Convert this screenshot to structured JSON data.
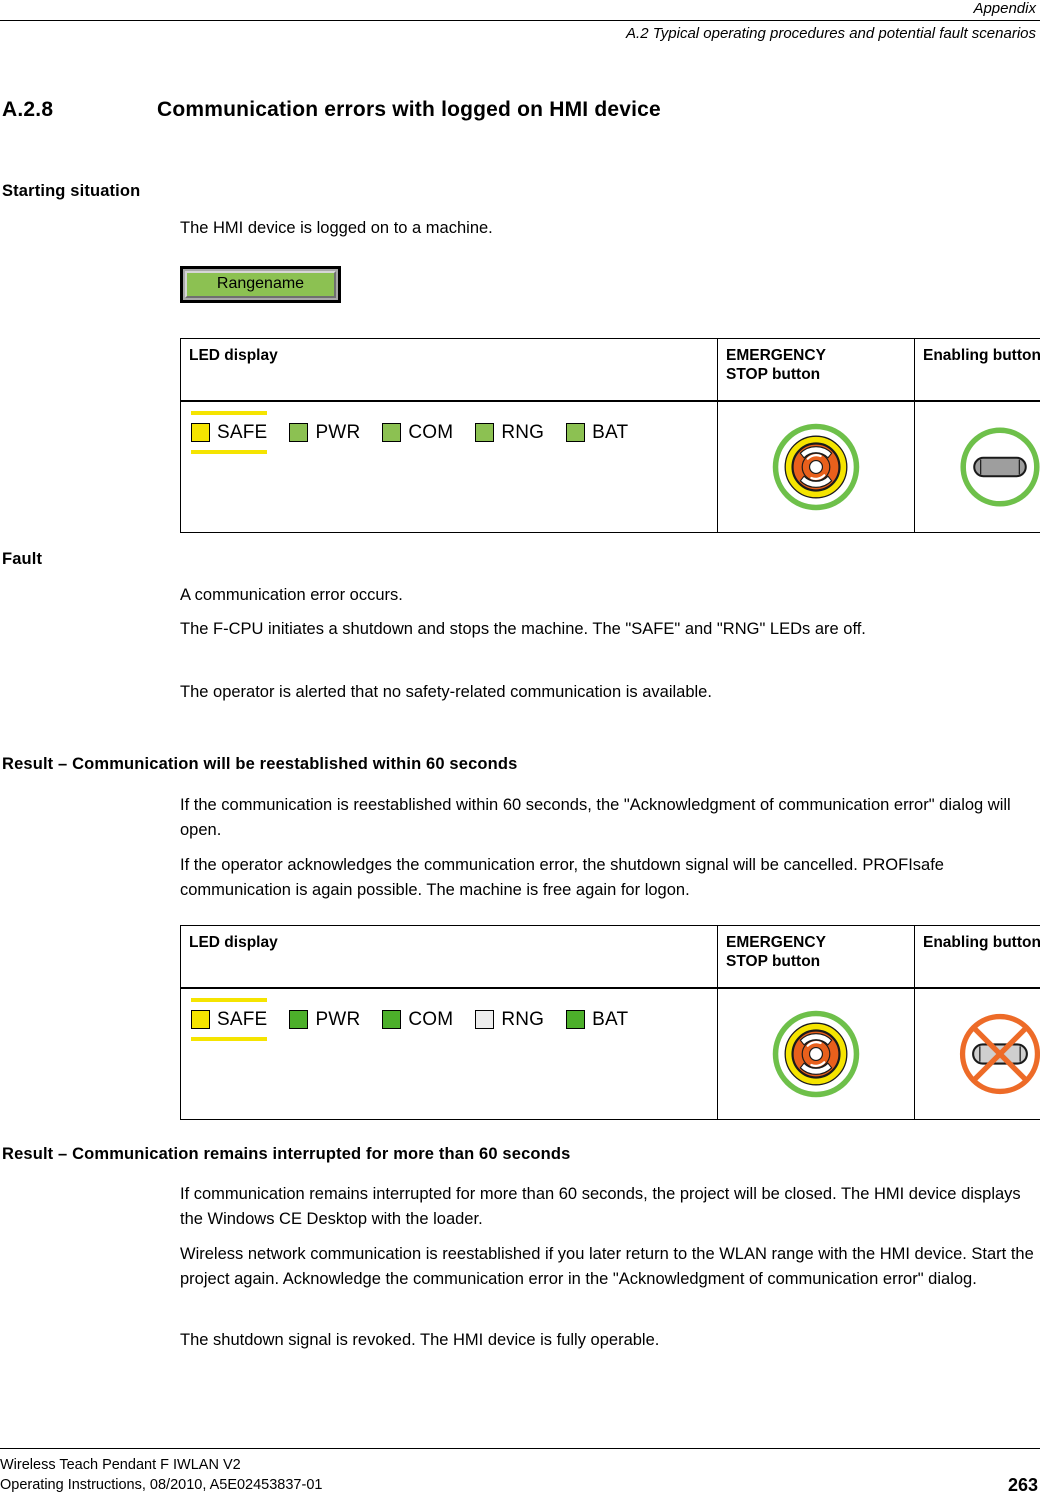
{
  "header": {
    "right_top": "Appendix",
    "right_sub": "A.2 Typical operating procedures and potential fault scenarios"
  },
  "section": {
    "number": "A.2.8",
    "title": "Communication errors with logged on HMI device"
  },
  "starting_situation": {
    "heading": "Starting situation",
    "paragraph": "The HMI device is logged on to a machine.",
    "rangename_button": "Rangename"
  },
  "table_headers": {
    "led": "LED display",
    "estop": "EMERGENCY STOP button",
    "estop_line1": "EMERGENCY",
    "estop_line2": "STOP button",
    "enabling": "Enabling button"
  },
  "table_one": {
    "leds": [
      {
        "label": "SAFE",
        "color": "#f5e400",
        "state": "on",
        "marked": true
      },
      {
        "label": "PWR",
        "color": "#8cc152",
        "state": "on",
        "marked": false
      },
      {
        "label": "COM",
        "color": "#8cc152",
        "state": "on",
        "marked": false
      },
      {
        "label": "RNG",
        "color": "#8cc152",
        "state": "on",
        "marked": false
      },
      {
        "label": "BAT",
        "color": "#8cc152",
        "state": "on",
        "marked": false
      }
    ],
    "estop_icon": "emergency-stop-button-icon",
    "enabling_icon": "enabling-button-icon",
    "enabling_disabled": false
  },
  "table_two": {
    "leds": [
      {
        "label": "SAFE",
        "color": "#f5e400",
        "state": "on",
        "marked": true
      },
      {
        "label": "PWR",
        "color": "#4caf2a",
        "state": "on",
        "marked": false
      },
      {
        "label": "COM",
        "color": "#4caf2a",
        "state": "on",
        "marked": false
      },
      {
        "label": "RNG",
        "color": "#ededed",
        "state": "off",
        "marked": false
      },
      {
        "label": "BAT",
        "color": "#4caf2a",
        "state": "on",
        "marked": false
      }
    ],
    "estop_icon": "emergency-stop-button-icon",
    "enabling_icon": "enabling-button-disabled-icon",
    "enabling_disabled": true
  },
  "fault": {
    "heading": "Fault",
    "p1": "A communication error occurs.",
    "p2": "The F-CPU initiates a shutdown and stops the machine. The \"SAFE\" and \"RNG\" LEDs are off.",
    "p3": "The operator is alerted that no safety-related communication is available."
  },
  "result_reestablished": {
    "heading": "Result – Communication will be reestablished within 60 seconds",
    "p1": "If the communication is reestablished within 60 seconds, the \"Acknowledgment of communication error\" dialog will open.",
    "p2": "If the operator acknowledges the communication error, the shutdown signal will be cancelled. PROFIsafe communication is again possible. The machine is free again for logon."
  },
  "result_interrupted": {
    "heading": "Result – Communication remains interrupted for more than 60 seconds",
    "p1": "If communication remains interrupted for more than 60 seconds, the project will be closed. The HMI device displays the Windows CE Desktop with the loader.",
    "p2": "Wireless network communication is reestablished if you later return to the WLAN range with the HMI device. Start the project again. Acknowledge the communication error in the \"Acknowledgment of communication error\" dialog.",
    "p3": "The shutdown signal is revoked. The HMI device is fully operable."
  },
  "footer": {
    "line1": "Wireless Teach Pendant F IWLAN V2",
    "line2": "Operating Instructions, 08/2010, A5E02453837-01",
    "page": "263"
  },
  "colors": {
    "led_green": "#8cc152",
    "led_green_bright": "#4caf2a",
    "led_yellow": "#f5e400",
    "led_off": "#ededed",
    "estop_orange": "#e8601c",
    "estop_yellow": "#f5e400",
    "ring_green": "#6ec04a",
    "prohibit_orange": "#ed6b28",
    "enabling_gray": "#9e9e9e"
  }
}
